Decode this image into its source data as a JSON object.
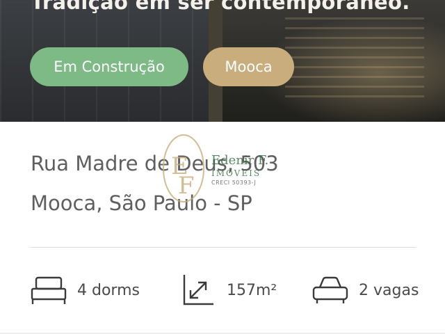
{
  "hero": {
    "title": "Tradição em ser contemporâneo.",
    "tags": [
      {
        "label": "Em Construção",
        "color": "#7dba85"
      },
      {
        "label": "Mooca",
        "color": "#c9ad7c"
      }
    ]
  },
  "address": {
    "line1": "Rua Madre de Deus, 503",
    "line2": "Mooca, São Paulo - SP"
  },
  "features": {
    "bedrooms": {
      "icon": "bed-icon",
      "label": "4 dorms"
    },
    "area": {
      "icon": "expand-arrow-icon",
      "label": "157m²"
    },
    "parking": {
      "icon": "car-icon",
      "label": "2 vagas"
    }
  },
  "watermark": {
    "monogram": "EF",
    "name": "Edenir F.",
    "subtitle": "IMÓVEIS",
    "creci": "CRECI 50393-J",
    "color": "#2f6b3c"
  }
}
